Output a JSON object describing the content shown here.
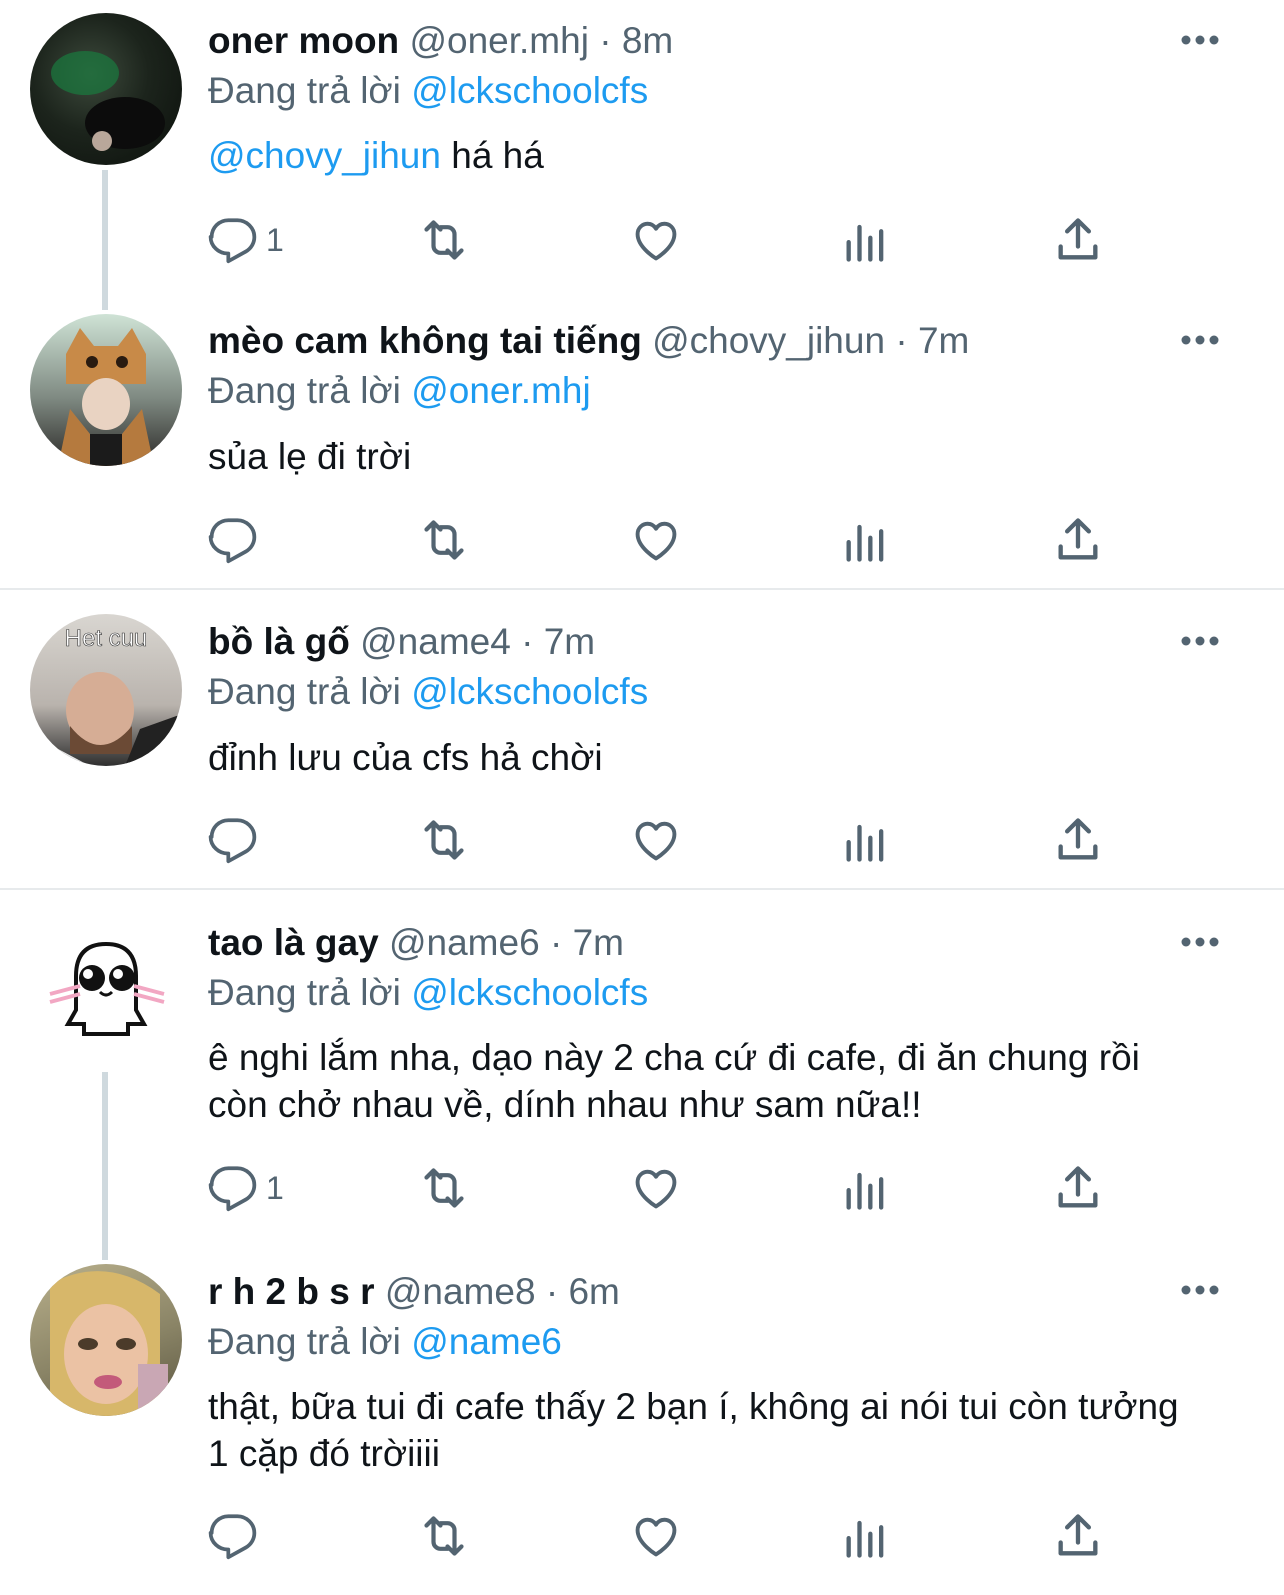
{
  "colors": {
    "link": "#1d9bf0",
    "muted": "#536471",
    "text": "#0f1419"
  },
  "tweets": [
    {
      "name": "oner moon",
      "handle": "@oner.mhj",
      "time": "8m",
      "reply_prefix": "Đang trả lời",
      "reply_to": "@lckschoolcfs",
      "text_mention": "@chovy_jihun",
      "text": " há há",
      "reply_count": "1"
    },
    {
      "name": "mèo cam không tai tiếng",
      "handle": "@chovy_jihun",
      "time": "7m",
      "reply_prefix": "Đang trả lời",
      "reply_to": "@oner.mhj",
      "text": "sủa lẹ đi trời",
      "reply_count": ""
    },
    {
      "name": "bồ là gố",
      "handle": "@name4",
      "time": "7m",
      "reply_prefix": "Đang trả lời",
      "reply_to": "@lckschoolcfs",
      "text": "đỉnh lưu của cfs hả chời",
      "reply_count": "",
      "avatar_caption": "Het cuu"
    },
    {
      "name": "tao là gay",
      "handle": "@name6",
      "time": "7m",
      "reply_prefix": "Đang trả lời",
      "reply_to": "@lckschoolcfs",
      "text": "ê nghi lắm nha, dạo này 2 cha cứ đi cafe, đi ăn chung rồi còn chở nhau về, dính nhau như sam nữa!!",
      "reply_count": "1"
    },
    {
      "name": "r h 2 b s r",
      "handle": "@name8",
      "time": "6m",
      "reply_prefix": "Đang trả lời",
      "reply_to": "@name6",
      "text": "thật, bữa tui đi cafe thấy 2 bạn í, không ai nói tui còn tưởng 1 cặp đó trờiiii",
      "reply_count": ""
    }
  ],
  "icons": [
    "reply-icon",
    "retweet-icon",
    "like-icon",
    "views-icon",
    "share-icon",
    "more-icon"
  ]
}
